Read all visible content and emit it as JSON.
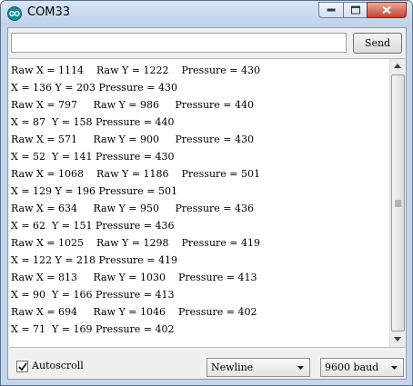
{
  "window": {
    "title": "COM33"
  },
  "input": {
    "value": "",
    "send_label": "Send"
  },
  "output": {
    "lines": [
      "Raw X = 1114    Raw Y = 1222    Pressure = 430",
      "X = 136 Y = 203 Pressure = 430",
      "Raw X = 797     Raw Y = 986     Pressure = 440",
      "X = 87  Y = 158 Pressure = 440",
      "Raw X = 571     Raw Y = 900     Pressure = 430",
      "X = 52  Y = 141 Pressure = 430",
      "Raw X = 1068    Raw Y = 1186    Pressure = 501",
      "X = 129 Y = 196 Pressure = 501",
      "Raw X = 634     Raw Y = 950     Pressure = 436",
      "X = 62  Y = 151 Pressure = 436",
      "Raw X = 1025    Raw Y = 1298    Pressure = 419",
      "X = 122 Y = 218 Pressure = 419",
      "Raw X = 813     Raw Y = 1030    Pressure = 413",
      "X = 90  Y = 166 Pressure = 413",
      "Raw X = 694     Raw Y = 1046    Pressure = 402",
      "X = 71  Y = 169 Pressure = 402"
    ]
  },
  "footer": {
    "autoscroll_label": "Autoscroll",
    "autoscroll_checked": true,
    "line_ending": "Newline",
    "baud_rate": "9600 baud"
  },
  "icons": {
    "app": "arduino-icon",
    "minimize": "minimize-icon",
    "maximize": "maximize-icon",
    "close": "close-icon"
  },
  "colors": {
    "titlebar": "#c3d6ec",
    "close_button": "#c7442e",
    "app_icon": "#1b8a95"
  }
}
